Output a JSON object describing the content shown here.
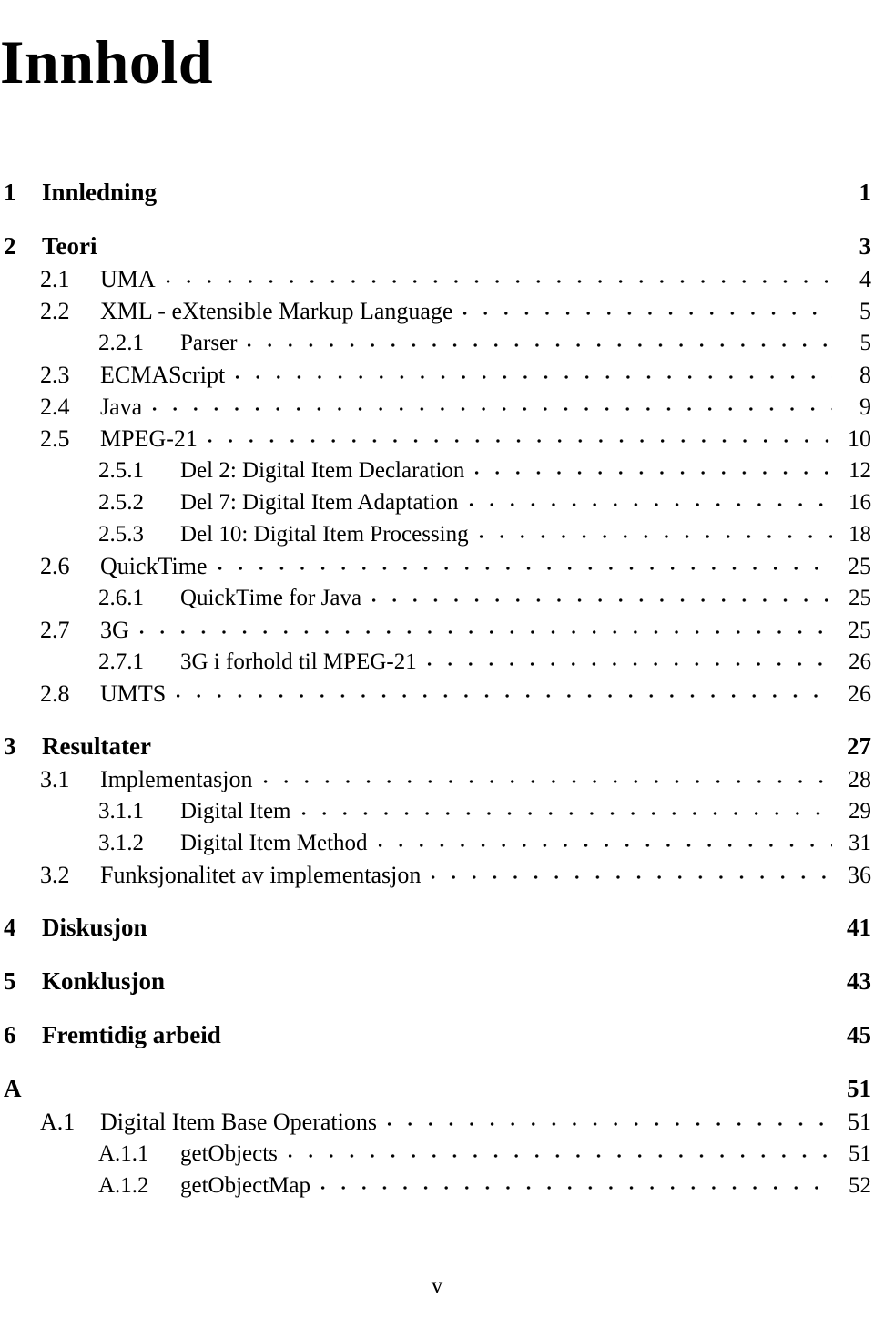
{
  "document": {
    "title": "Innhold",
    "folio": "v"
  },
  "toc": {
    "entries": [
      {
        "level": 1,
        "number": "1",
        "title": "Innledning",
        "page": "1",
        "leader": false
      },
      {
        "level": 1,
        "number": "2",
        "title": "Teori",
        "page": "3",
        "leader": false
      },
      {
        "level": 2,
        "number": "2.1",
        "title": "UMA",
        "page": "4",
        "leader": true
      },
      {
        "level": 2,
        "number": "2.2",
        "title": "XML - eXtensible Markup Language",
        "page": "5",
        "leader": true
      },
      {
        "level": 3,
        "number": "2.2.1",
        "title": "Parser",
        "page": "5",
        "leader": true
      },
      {
        "level": 2,
        "number": "2.3",
        "title": "ECMAScript",
        "page": "8",
        "leader": true
      },
      {
        "level": 2,
        "number": "2.4",
        "title": "Java",
        "page": "9",
        "leader": true
      },
      {
        "level": 2,
        "number": "2.5",
        "title": "MPEG-21",
        "page": "10",
        "leader": true
      },
      {
        "level": 3,
        "number": "2.5.1",
        "title": "Del 2: Digital Item Declaration",
        "page": "12",
        "leader": true
      },
      {
        "level": 3,
        "number": "2.5.2",
        "title": "Del 7: Digital Item Adaptation",
        "page": "16",
        "leader": true
      },
      {
        "level": 3,
        "number": "2.5.3",
        "title": "Del 10: Digital Item Processing",
        "page": "18",
        "leader": true
      },
      {
        "level": 2,
        "number": "2.6",
        "title": "QuickTime",
        "page": "25",
        "leader": true
      },
      {
        "level": 3,
        "number": "2.6.1",
        "title": "QuickTime for Java",
        "page": "25",
        "leader": true
      },
      {
        "level": 2,
        "number": "2.7",
        "title": "3G",
        "page": "25",
        "leader": true
      },
      {
        "level": 3,
        "number": "2.7.1",
        "title": "3G i forhold til MPEG-21",
        "page": "26",
        "leader": true
      },
      {
        "level": 2,
        "number": "2.8",
        "title": "UMTS",
        "page": "26",
        "leader": true
      },
      {
        "level": 1,
        "number": "3",
        "title": "Resultater",
        "page": "27",
        "leader": false
      },
      {
        "level": 2,
        "number": "3.1",
        "title": "Implementasjon",
        "page": "28",
        "leader": true
      },
      {
        "level": 3,
        "number": "3.1.1",
        "title": "Digital Item",
        "page": "29",
        "leader": true
      },
      {
        "level": 3,
        "number": "3.1.2",
        "title": "Digital Item Method",
        "page": "31",
        "leader": true
      },
      {
        "level": 2,
        "number": "3.2",
        "title": "Funksjonalitet av implementasjon",
        "page": "36",
        "leader": true
      },
      {
        "level": 1,
        "number": "4",
        "title": "Diskusjon",
        "page": "41",
        "leader": false
      },
      {
        "level": 1,
        "number": "5",
        "title": "Konklusjon",
        "page": "43",
        "leader": false
      },
      {
        "level": 1,
        "number": "6",
        "title": "Fremtidig arbeid",
        "page": "45",
        "leader": false
      },
      {
        "level": 1,
        "number": "A",
        "title": "",
        "page": "51",
        "leader": false
      },
      {
        "level": 2,
        "number": "A.1",
        "title": "Digital Item Base Operations",
        "page": "51",
        "leader": true
      },
      {
        "level": 3,
        "number": "A.1.1",
        "title": "getObjects",
        "page": "51",
        "leader": true
      },
      {
        "level": 3,
        "number": "A.1.2",
        "title": "getObjectMap",
        "page": "52",
        "leader": true
      }
    ]
  }
}
